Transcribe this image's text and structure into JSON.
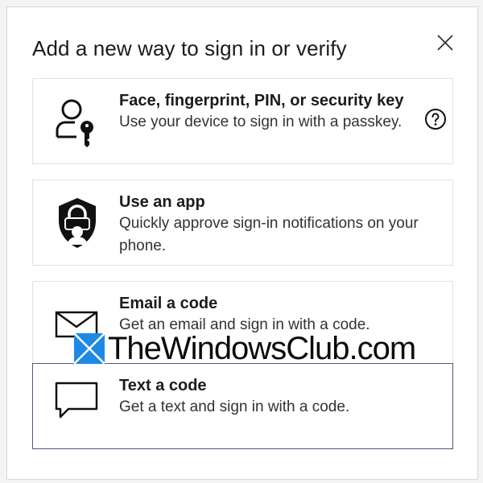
{
  "dialog": {
    "title": "Add a new way to sign in or verify"
  },
  "options": [
    {
      "icon": "person-key-icon",
      "title": "Face, fingerprint, PIN, or security key",
      "description": "Use your device to sign in with a passkey."
    },
    {
      "icon": "authenticator-app-icon",
      "title": "Use an app",
      "description": "Quickly approve sign-in notifications on your phone."
    },
    {
      "icon": "envelope-icon",
      "title": "Email a code",
      "description": "Get an email and sign in with a code."
    },
    {
      "icon": "chat-bubble-icon",
      "title": "Text a code",
      "description": "Get a text and sign in with a code.",
      "selected": true
    }
  ],
  "watermark": {
    "text": "TheWindowsClub.com",
    "logo_color": "#1e88e5"
  }
}
